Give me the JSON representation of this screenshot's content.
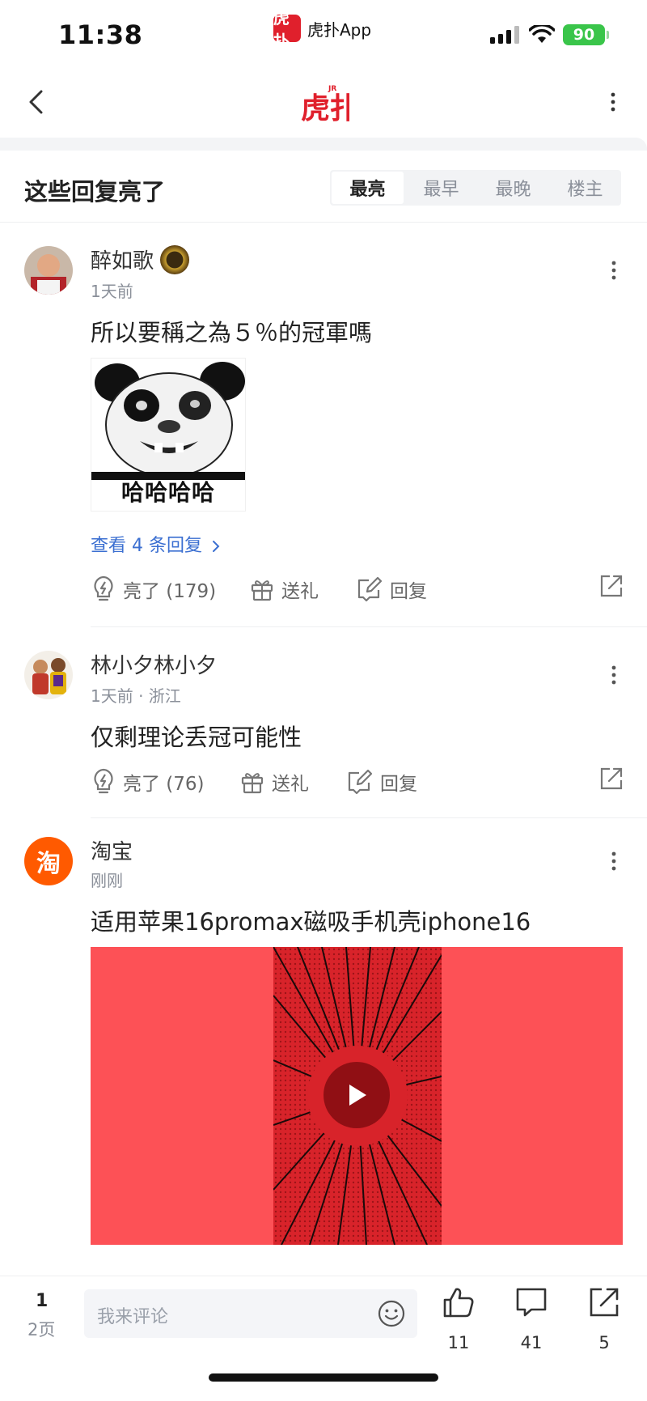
{
  "status": {
    "time": "11:38",
    "app_name": "虎扑App",
    "app_logo_text": "虎扑",
    "battery": "90"
  },
  "nav": {
    "logo_text": "虎扑",
    "logo_badge": "JR"
  },
  "section": {
    "title": "这些回复亮了",
    "sort_tabs": [
      "最亮",
      "最早",
      "最晚",
      "楼主"
    ],
    "active_tab": "最亮"
  },
  "comments": [
    {
      "user": "醉如歌",
      "time": "1天前",
      "text": "所以要稱之為５％的冠軍嗎",
      "meme_caption": "哈哈哈哈",
      "view_replies": "查看 4 条回复",
      "like_label": "亮了 (179)",
      "gift_label": "送礼",
      "reply_label": "回复"
    },
    {
      "user": "林小夕林小夕",
      "time": "1天前 · 浙江",
      "text": "仅剩理论丢冠可能性",
      "like_label": "亮了 (76)",
      "gift_label": "送礼",
      "reply_label": "回复"
    }
  ],
  "ad": {
    "logo_text": "淘",
    "advertiser": "淘宝",
    "time": "刚刚",
    "title": "适用苹果16promax磁吸手机壳iphone16"
  },
  "bottom": {
    "page_current": "1",
    "page_total": "2页",
    "comment_placeholder": "我来评论",
    "like_count": "11",
    "comment_count": "41",
    "share_count": "5"
  },
  "colors": {
    "accent_red": "#e0202c",
    "link_blue": "#3b6fd1",
    "ad_red": "#fd5156",
    "taobao_orange": "#ff5a00"
  }
}
